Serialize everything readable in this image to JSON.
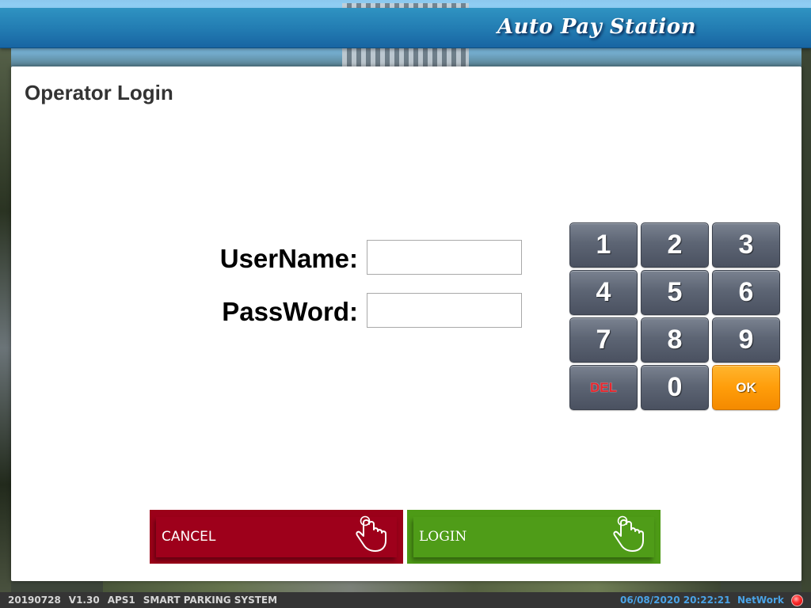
{
  "header": {
    "title": "Auto Pay Station",
    "color": "#2179b0"
  },
  "panel": {
    "title": "Operator Login"
  },
  "form": {
    "username_label": "UserName:",
    "username_value": "",
    "password_label": "PassWord:",
    "password_value": ""
  },
  "keypad": {
    "keys": [
      "1",
      "2",
      "3",
      "4",
      "5",
      "6",
      "7",
      "8",
      "9",
      "DEL",
      "0",
      "OK"
    ],
    "del_color": "#e8262d",
    "ok_color": "#ff9d0a"
  },
  "actions": {
    "cancel_label": "CANCEL",
    "cancel_icon": "hand-pointer-icon",
    "cancel_color": "#9e001b",
    "login_label": "LOGIN",
    "login_icon": "hand-pointer-icon",
    "login_color": "#4f9c18"
  },
  "status": {
    "build": "20190728",
    "version": "V1.30",
    "station": "APS1",
    "system_name": "SMART PARKING SYSTEM",
    "datetime": "06/08/2020 20:22:21",
    "network_label": "NetWork",
    "network_state": "disconnected",
    "network_indicator_color": "#ff3030"
  }
}
